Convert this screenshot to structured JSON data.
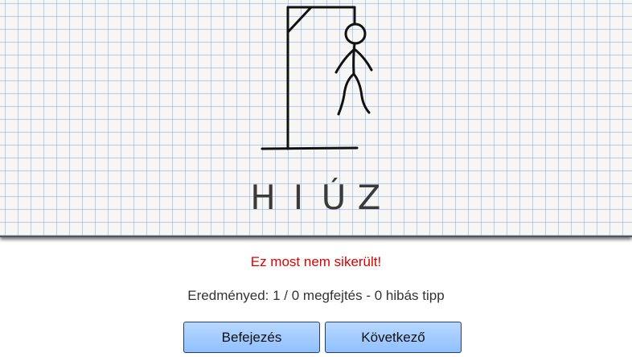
{
  "word": {
    "letters": [
      "H",
      "I",
      "Ú",
      "Z"
    ]
  },
  "message": "Ez most nem sikerült!",
  "score": "Eredményed: 1 / 0 megfejtés - 0 hibás tipp",
  "buttons": {
    "finish_label": "Befejezés",
    "next_label": "Következő"
  },
  "colors": {
    "message": "#e00000",
    "button_top": "#b8d8ff",
    "button_bottom": "#8fc0ff"
  }
}
